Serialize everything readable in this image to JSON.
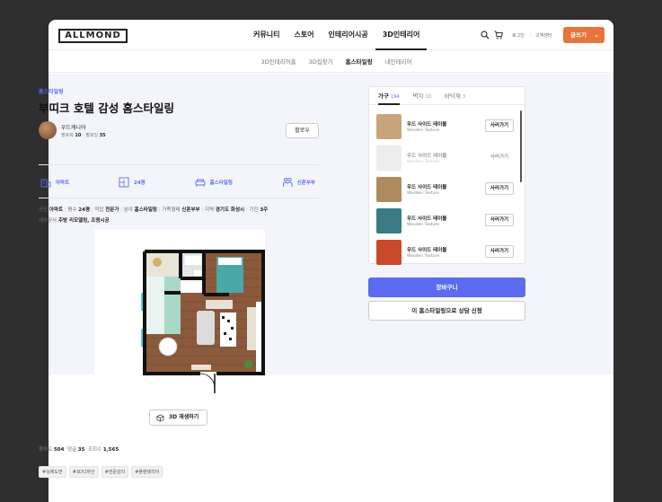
{
  "header": {
    "logo": "ALLMOND",
    "nav": [
      "커뮤니티",
      "스토어",
      "인테리어시공",
      "3D인테리어"
    ],
    "active_nav": "3D인테리어",
    "login": "로그인",
    "support": "고객센터",
    "write_label": "글쓰기"
  },
  "subnav": {
    "items": [
      "3D인테리어홈",
      "3D집찾기",
      "홈스타일링",
      "내인테리어"
    ],
    "active": "홈스타일링"
  },
  "post": {
    "category": "홈스타일링",
    "title": "부띠크 호텔 감성 홈스타일링",
    "author": "우드캐니아",
    "followers_label": "팔로워",
    "followers": "10",
    "following_label": "팔로잉",
    "following": "35",
    "follow_label": "팔로우",
    "info": [
      {
        "icon": "building-icon",
        "label": "아파트"
      },
      {
        "icon": "floorplan-icon",
        "label": "24평"
      },
      {
        "icon": "sofa-icon",
        "label": "홈스타일링"
      },
      {
        "icon": "couple-icon",
        "label": "신혼부부"
      }
    ],
    "specs_line1": [
      {
        "k": "공간",
        "v": "아파트"
      },
      {
        "k": "평수",
        "v": "24평"
      },
      {
        "k": "작업",
        "v": "전문가"
      },
      {
        "k": "분야",
        "v": "홈스타일링"
      },
      {
        "k": "가족형태",
        "v": "신혼부부"
      },
      {
        "k": "지역",
        "v": "경기도 화성시"
      },
      {
        "k": "기간",
        "v": "3주"
      }
    ],
    "specs_line2": {
      "k": "세부공사",
      "v": "주방 리모델링, 조명시공"
    },
    "replay_label": "3D 재생하기",
    "stats": [
      {
        "k": "좋아요",
        "v": "504"
      },
      {
        "k": "댓글",
        "v": "35"
      },
      {
        "k": "조회수",
        "v": "1,565"
      }
    ],
    "tags": [
      "#실제도면",
      "#3D디자인",
      "#전문감리",
      "#플랜테리어"
    ]
  },
  "panel": {
    "tabs": [
      {
        "label": "가구",
        "count": "194"
      },
      {
        "label": "벽지",
        "count": "10"
      },
      {
        "label": "바닥재",
        "count": "3"
      }
    ],
    "products": [
      {
        "name": "우드 사이드 테이블",
        "brand": "Wooden Texture",
        "buy": "사러가기",
        "color": "#c9a57c"
      },
      {
        "name": "우드 사이드 테이블",
        "brand": "Wooden Texture",
        "buy": "사러가기",
        "color": "#d8d8d8"
      },
      {
        "name": "우드 사이드 테이블",
        "brand": "Wooden Texture",
        "buy": "사러가기",
        "color": "#b08a5f"
      },
      {
        "name": "우드 사이드 테이블",
        "brand": "Wooden Texture",
        "buy": "사러가기",
        "color": "#3a7c84"
      },
      {
        "name": "우드 사이드 테이블",
        "brand": "Wooden Texture",
        "buy": "사러가기",
        "color": "#c94a2a"
      }
    ],
    "cart_label": "장바구니",
    "consult_label": "이 홈스타일링으로 상담 신청"
  },
  "colors": {
    "accent": "#5b6cf0",
    "write_button": "#e8743a",
    "page_bg": "#f4f5fa"
  }
}
